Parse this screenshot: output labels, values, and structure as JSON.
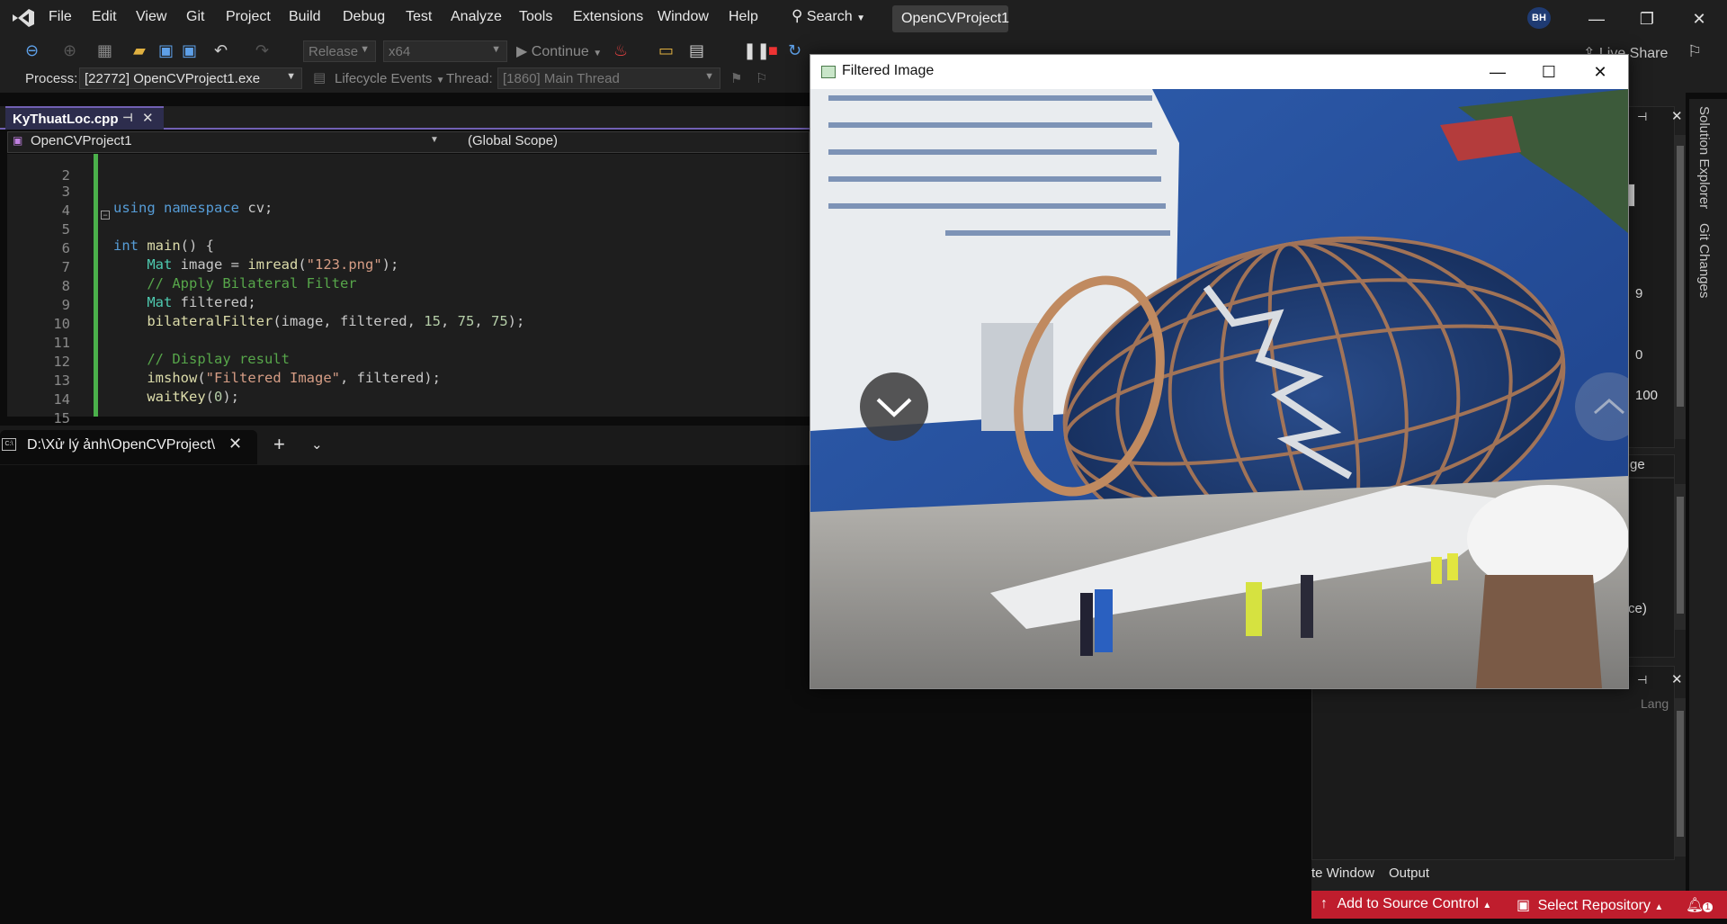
{
  "menu": {
    "items": [
      "File",
      "Edit",
      "View",
      "Git",
      "Project",
      "Build",
      "Debug",
      "Test",
      "Analyze",
      "Tools",
      "Extensions",
      "Window",
      "Help"
    ],
    "search_label": "Search",
    "solution_name": "OpenCVProject1",
    "user_initials": "BH"
  },
  "toolbar": {
    "configuration": "Release",
    "platform": "x64",
    "continue_label": "Continue",
    "live_share_label": "Live Share"
  },
  "debug_bar": {
    "process_label": "Process:",
    "process_value": "[22772] OpenCVProject1.exe",
    "lifecycle_label": "Lifecycle Events",
    "thread_label": "Thread:",
    "thread_value": "[1860] Main Thread"
  },
  "editor": {
    "file_tab": "KyThuatLoc.cpp",
    "project_combo": "OpenCVProject1",
    "scope_combo": "(Global Scope)",
    "line_numbers": [
      "2",
      "3",
      "4",
      "5",
      "6",
      "7",
      "8",
      "9",
      "10",
      "11",
      "12",
      "13",
      "14",
      "15"
    ]
  },
  "terminal": {
    "tab_title": "D:\\Xử lý ảnh\\OpenCVProject\\"
  },
  "right_dock": {
    "values": [
      "9",
      "0",
      "100"
    ],
    "partial_tab_text": "ge",
    "partial_item_text": "ce)",
    "lang_label": "Lang",
    "tool_tab_window": "te Window",
    "tool_tab_output": "Output",
    "vertical_tabs": [
      "Solution Explorer",
      "Git Changes"
    ]
  },
  "status_bar": {
    "add_to_source_control": "Add to Source Control",
    "select_repository": "Select Repository",
    "notification_count": "1"
  },
  "cv_window": {
    "title": "Filtered Image"
  },
  "colors": {
    "accent": "#7160b3",
    "status_bar": "#bf1d2d",
    "git_change_bar": "#4bb04b"
  }
}
